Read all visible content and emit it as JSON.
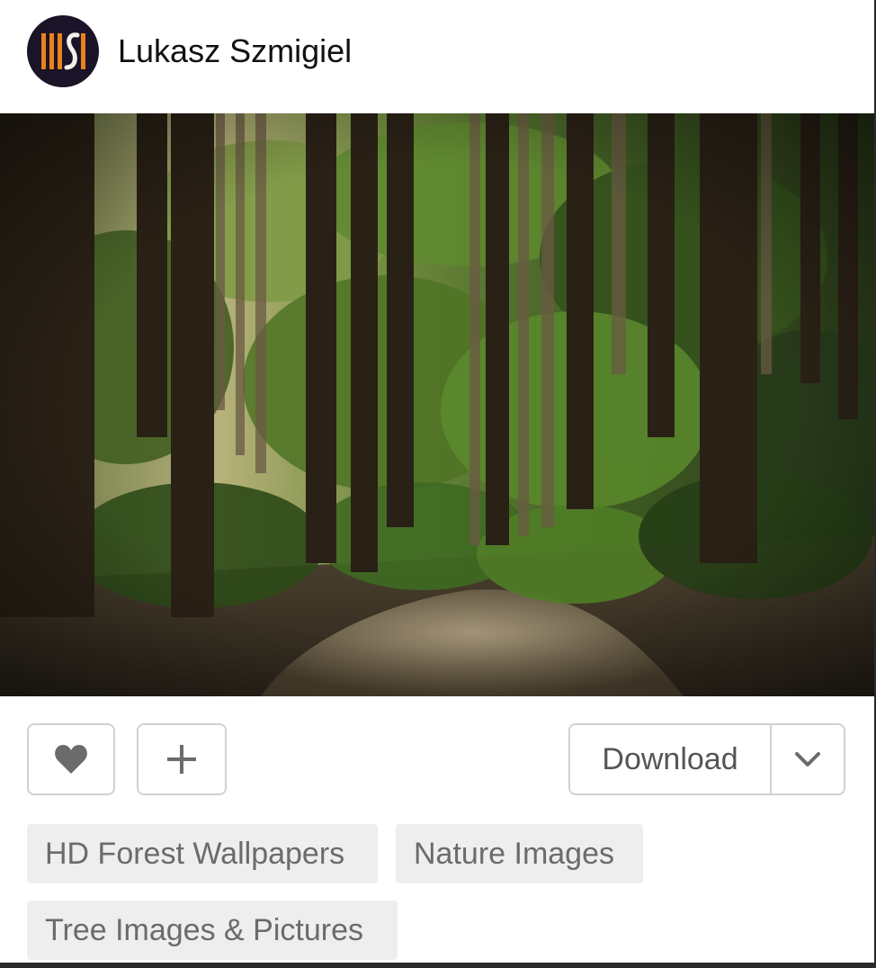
{
  "author": {
    "name": "Lukasz Szmigiel",
    "avatar_icon": "author-logo",
    "avatar_background": "#1b1327",
    "avatar_accent": "#e8821e"
  },
  "photo": {
    "subject_icon": "forest-path-photo"
  },
  "actions": {
    "like_icon": "heart-icon",
    "collect_icon": "plus-icon",
    "download_label": "Download",
    "download_menu_icon": "chevron-down-icon"
  },
  "tags": [
    {
      "label": "HD Forest Wallpapers"
    },
    {
      "label": "Nature Images"
    },
    {
      "label": "Tree Images & Pictures"
    }
  ],
  "colors": {
    "button_border": "#d1d1d1",
    "icon_gray": "#6b6b6b",
    "tag_background": "#eeeeee",
    "tag_text": "#6b6b6b"
  }
}
